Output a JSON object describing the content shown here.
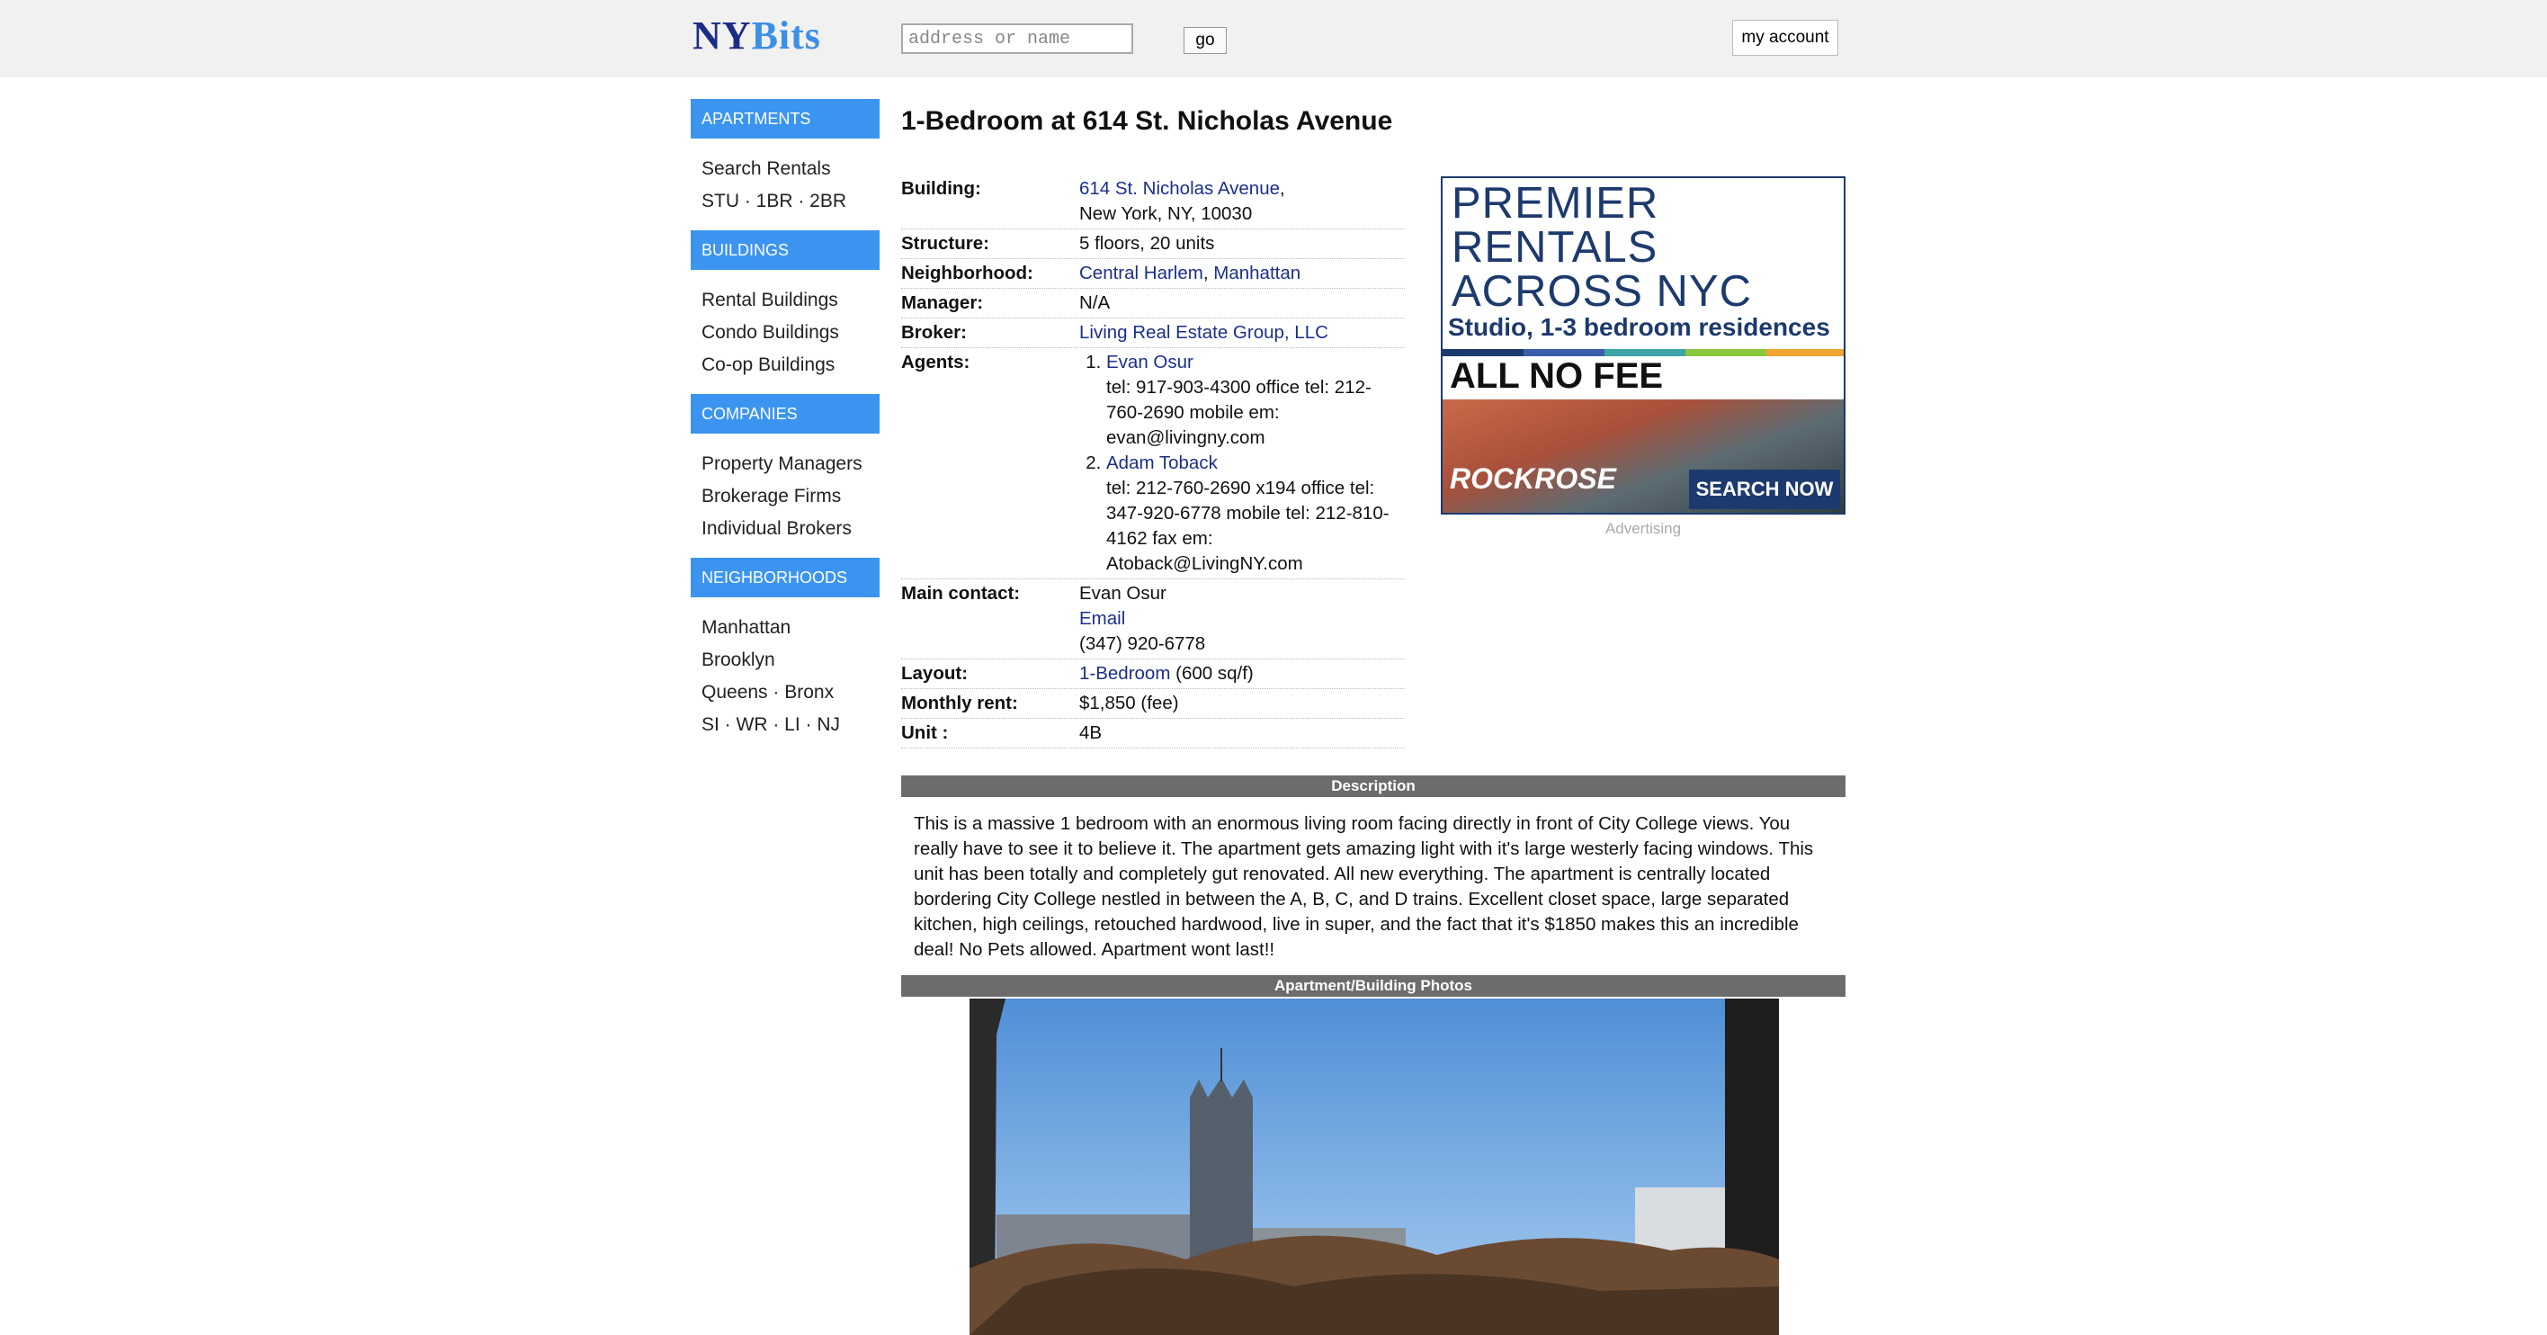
{
  "header": {
    "logo_ny": "NY",
    "logo_bits": "Bits",
    "search_placeholder": "address or name",
    "go_label": "go",
    "account_label": "my account"
  },
  "sidebar": {
    "sections": [
      {
        "title": "APARTMENTS",
        "items": [
          "Search Rentals",
          "STU · 1BR · 2BR"
        ]
      },
      {
        "title": "BUILDINGS",
        "items": [
          "Rental Buildings",
          "Condo Buildings",
          "Co-op Buildings"
        ]
      },
      {
        "title": "COMPANIES",
        "items": [
          "Property Managers",
          "Brokerage Firms",
          "Individual Brokers"
        ]
      },
      {
        "title": "NEIGHBORHOODS",
        "items": [
          "Manhattan",
          "Brooklyn",
          "Queens · Bronx",
          "SI · WR · LI · NJ"
        ]
      }
    ]
  },
  "listing": {
    "title": "1-Bedroom at 614 St. Nicholas Avenue",
    "labels": {
      "building": "Building:",
      "structure": "Structure:",
      "neighborhood": "Neighborhood:",
      "manager": "Manager:",
      "broker": "Broker:",
      "agents": "Agents:",
      "main_contact": "Main contact:",
      "layout": "Layout:",
      "rent": "Monthly rent:",
      "unit": "Unit :"
    },
    "building_link": "614 St. Nicholas Avenue",
    "building_city": "New York, NY, 10030",
    "structure": "5 floors, 20 units",
    "neighborhood_1": "Central Harlem",
    "neighborhood_2": "Manhattan",
    "manager": "N/A",
    "broker": "Living Real Estate Group, LLC",
    "agents": [
      {
        "name": "Evan Osur",
        "details": "tel: 917-903-4300 office tel: 212-760-2690 mobile em: evan@livingny.com"
      },
      {
        "name": "Adam Toback",
        "details": "tel: 212-760-2690 x194 office tel: 347-920-6778 mobile tel: 212-810-4162 fax em: Atoback@LivingNY.com"
      }
    ],
    "main_contact_name": "Evan Osur",
    "main_contact_email": "Email",
    "main_contact_phone": "(347) 920-6778",
    "layout_link": "1-Bedroom",
    "layout_size": "(600 sq/f)",
    "rent": "$1,850 (fee)",
    "unit": "4B"
  },
  "ad": {
    "headline_1": "PREMIER",
    "headline_2": "RENTALS",
    "headline_3": "ACROSS NYC",
    "sub": "Studio, 1-3 bedroom residences",
    "nofee": "ALL NO FEE",
    "brand": "ROCKROSE",
    "cta": "SEARCH NOW",
    "caption": "Advertising"
  },
  "description": {
    "heading": "Description",
    "text": "This is a massive 1 bedroom with an enormous living room facing directly in front of City College views. You really have to see it to believe it. The apartment gets amazing light with it's large westerly facing windows. This unit has been totally and completely gut renovated. All new everything. The apartment is centrally located bordering City College nestled in between the A, B, C, and D trains. Excellent closet space, large separated kitchen, high ceilings, retouched hardwood, live in super, and the fact that it's $1850 makes this an incredible deal! No Pets allowed. Apartment wont last!!"
  },
  "photos": {
    "heading": "Apartment/Building Photos"
  }
}
